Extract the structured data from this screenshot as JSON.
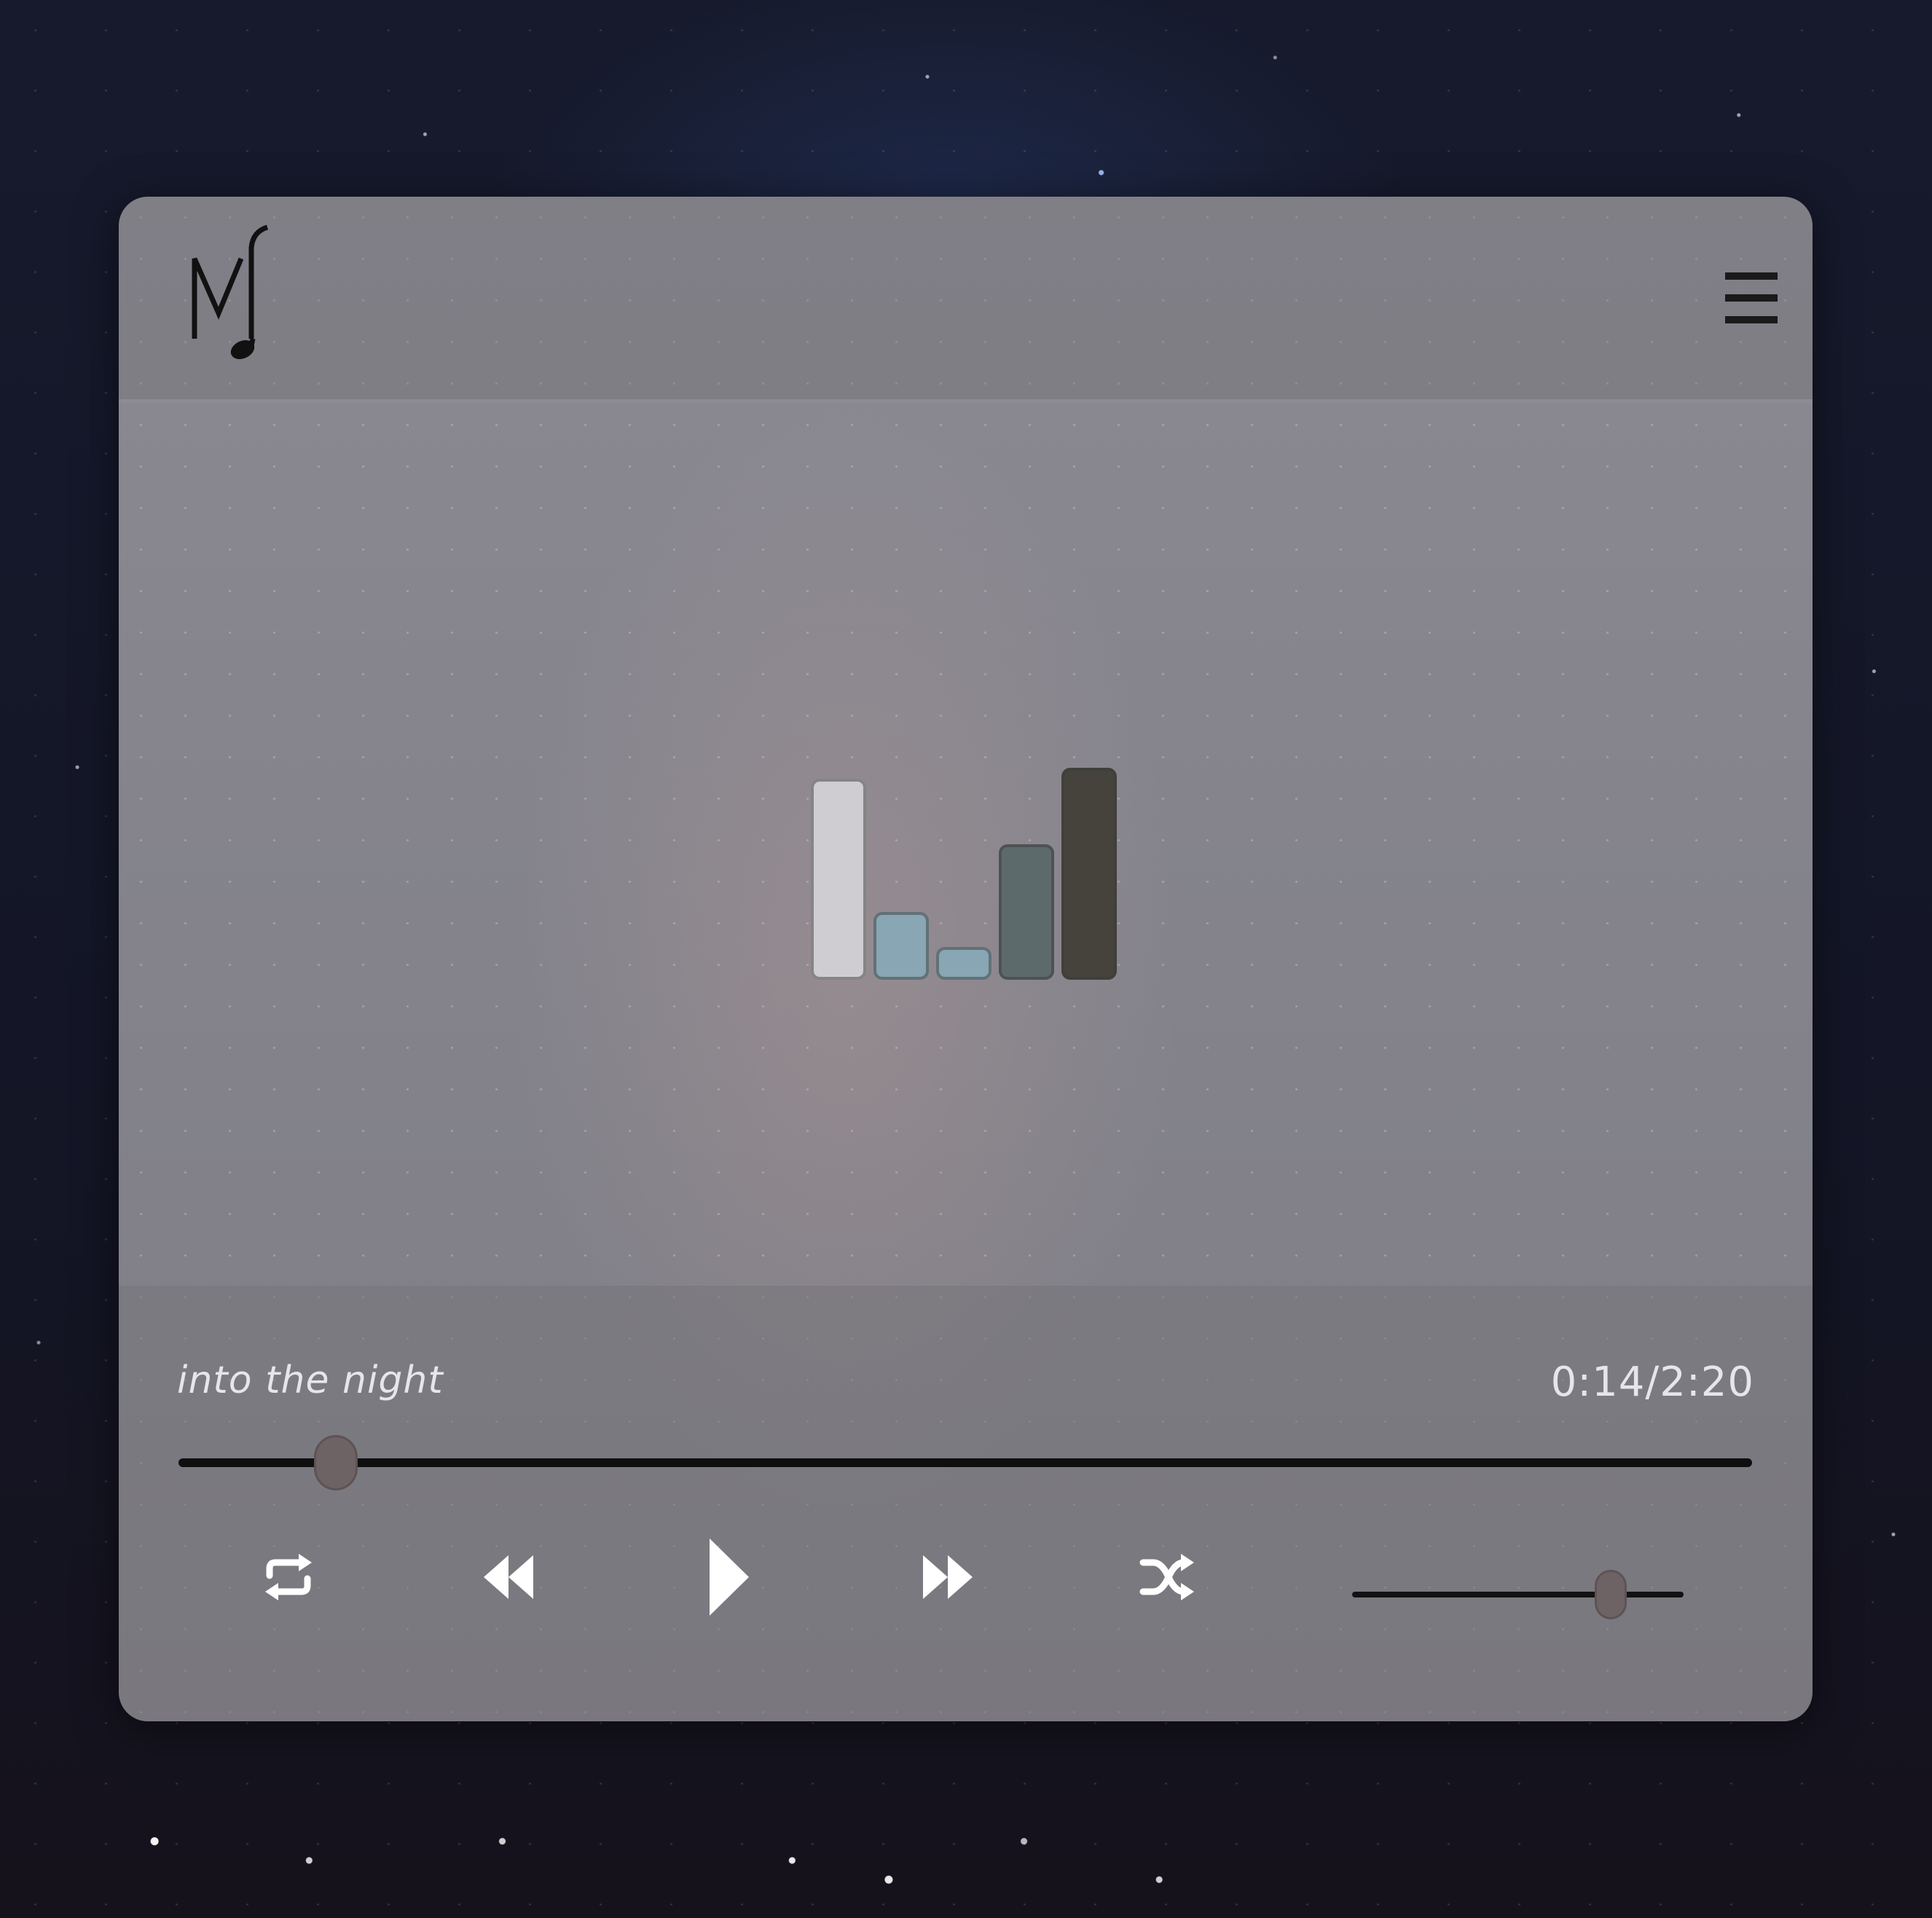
{
  "colors": {
    "card_bg": "#86858d",
    "text": "#e6e5ea",
    "track": "#0f0f10",
    "thumb": "#6d6364",
    "icon": "#ffffff"
  },
  "header": {
    "logo_icon": "music-note-logo-icon",
    "menu_icon": "hamburger-menu-icon"
  },
  "equalizer": {
    "levels": [
      0.92,
      0.31,
      0.15,
      0.62,
      0.97
    ],
    "colors": [
      "#cfcdd1",
      "#88a6b3",
      "#88a6b3",
      "#5d6a6b",
      "#45433b"
    ]
  },
  "now_playing": {
    "title": "into the night",
    "elapsed": "0:14",
    "separator": "/",
    "duration": "2:20",
    "progress": 0.1
  },
  "controls": {
    "repeat_icon": "repeat-icon",
    "rewind_icon": "rewind-icon",
    "play_icon": "play-icon",
    "forward_icon": "fast-forward-icon",
    "shuffle_icon": "shuffle-icon"
  },
  "volume": {
    "level": 0.78
  }
}
